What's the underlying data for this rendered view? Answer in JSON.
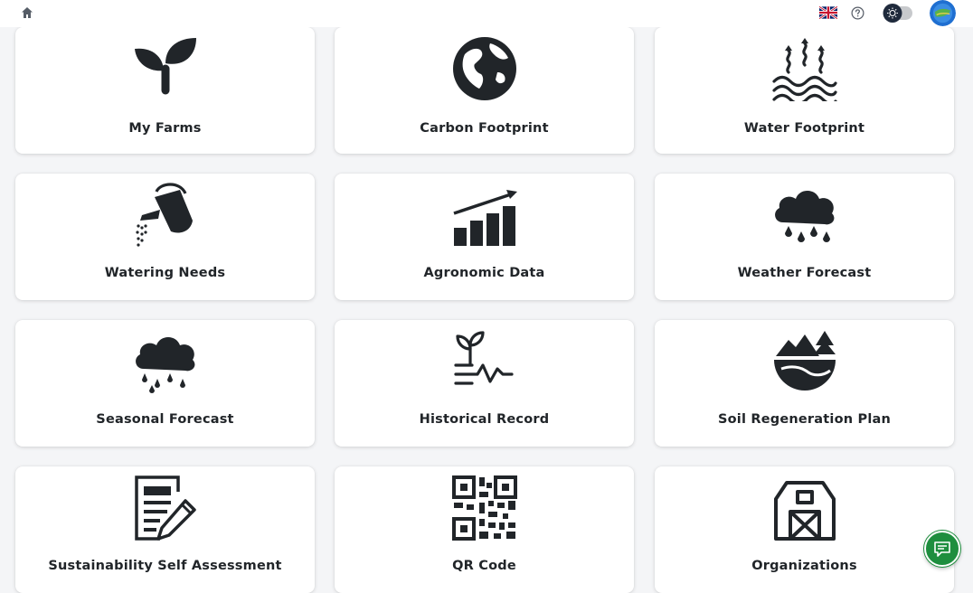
{
  "header": {
    "home_icon": "home-icon",
    "language_icon": "uk-flag-icon",
    "help_icon": "help-circle-icon",
    "theme_toggle_icon": "sun-icon",
    "avatar_icon": "globe-avatar-icon"
  },
  "cards": [
    {
      "label": "My Farms",
      "icon": "sprout-icon"
    },
    {
      "label": "Carbon Footprint",
      "icon": "earth-icon"
    },
    {
      "label": "Water Footprint",
      "icon": "water-evaporation-icon"
    },
    {
      "label": "Watering Needs",
      "icon": "watering-can-icon"
    },
    {
      "label": "Agronomic Data",
      "icon": "growth-chart-icon"
    },
    {
      "label": "Weather Forecast",
      "icon": "rain-cloud-icon"
    },
    {
      "label": "Seasonal Forecast",
      "icon": "rain-cloud-icon"
    },
    {
      "label": "Historical Record",
      "icon": "plant-history-icon"
    },
    {
      "label": "Soil Regeneration Plan",
      "icon": "soil-landscape-icon"
    },
    {
      "label": "Sustainability Self Assessment",
      "icon": "document-edit-icon"
    },
    {
      "label": "QR Code",
      "icon": "qr-code-icon"
    },
    {
      "label": "Organizations",
      "icon": "barn-icon"
    }
  ],
  "chat": {
    "icon": "chat-icon"
  },
  "colors": {
    "icon": "#212529",
    "chat": "#1e8e3e",
    "background": "#f4f5f7"
  }
}
